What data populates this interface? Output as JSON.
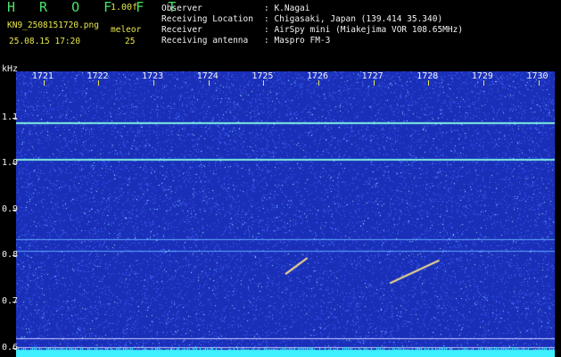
{
  "header": {
    "app_title": "H R O F F T",
    "version": "1.00f",
    "filename": "KN9_2508151720.png",
    "mode": "meleor",
    "datetime": "25.08.15 17:20",
    "count": "25",
    "info": [
      {
        "label": "Observer",
        "value": ": K.Nagai"
      },
      {
        "label": "Receiving Location",
        "value": ": Chigasaki, Japan (139.414 35.340)"
      },
      {
        "label": "Receiver",
        "value": ": AirSpy mini (Miakejima VOR 108.65MHz)"
      },
      {
        "label": "Receiving antenna",
        "value": ": Maspro FM-3"
      }
    ]
  },
  "spectrogram": {
    "y_unit": "kHz",
    "y_ticks": [
      "1.1",
      "1.0",
      "0.9",
      "0.8",
      "0.7",
      "0.6"
    ],
    "y_range_khz": [
      0.58,
      1.2
    ],
    "x_ticks": [
      "1721",
      "1722",
      "1723",
      "1724",
      "1725",
      "1726",
      "1727",
      "1728",
      "1729",
      "1730"
    ],
    "x_range_minutes": [
      1720.5,
      1730.3
    ],
    "carrier_lines_khz": [
      1.09,
      1.01,
      0.835,
      0.81,
      0.62,
      0.602
    ],
    "meteor_echoes": [
      {
        "start_minute": 1725.4,
        "end_minute": 1725.8,
        "start_khz": 0.76,
        "end_khz": 0.795
      },
      {
        "start_minute": 1727.3,
        "end_minute": 1728.2,
        "start_khz": 0.74,
        "end_khz": 0.79
      }
    ],
    "colors": {
      "background": "#1a2fb8",
      "noise_low": "#3b5bff",
      "noise_high": "#8fe8ff",
      "carrier": "#7ff0e0",
      "bottom_band": "#3ff0ff"
    }
  }
}
